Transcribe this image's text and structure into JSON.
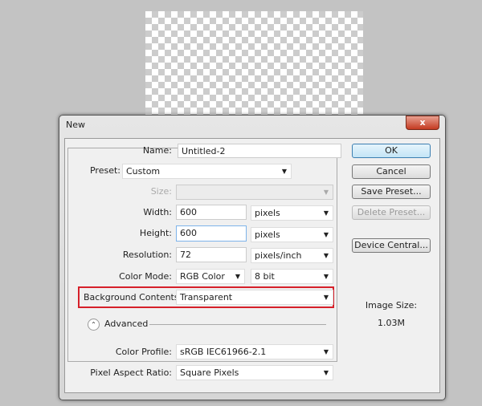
{
  "dialog": {
    "title": "New",
    "close": "x"
  },
  "form": {
    "name_label": "Name:",
    "name_value": "Untitled-2",
    "preset_label": "Preset:",
    "preset_value": "Custom",
    "size_label": "Size:",
    "size_value": "",
    "width_label": "Width:",
    "width_value": "600",
    "width_unit": "pixels",
    "height_label": "Height:",
    "height_value": "600",
    "height_unit": "pixels",
    "resolution_label": "Resolution:",
    "resolution_value": "72",
    "resolution_unit": "pixels/inch",
    "color_mode_label": "Color Mode:",
    "color_mode_value": "RGB Color",
    "bit_depth_value": "8 bit",
    "bg_label": "Background Contents:",
    "bg_value": "Transparent",
    "advanced_label": "Advanced",
    "color_profile_label": "Color Profile:",
    "color_profile_value": "sRGB IEC61966-2.1",
    "par_label": "Pixel Aspect Ratio:",
    "par_value": "Square Pixels"
  },
  "buttons": {
    "ok": "OK",
    "cancel": "Cancel",
    "save_preset": "Save Preset...",
    "delete_preset": "Delete Preset...",
    "device_central": "Device Central..."
  },
  "info": {
    "image_size_label": "Image Size:",
    "image_size_value": "1.03M"
  },
  "colors": {
    "highlight": "#d6202a"
  }
}
